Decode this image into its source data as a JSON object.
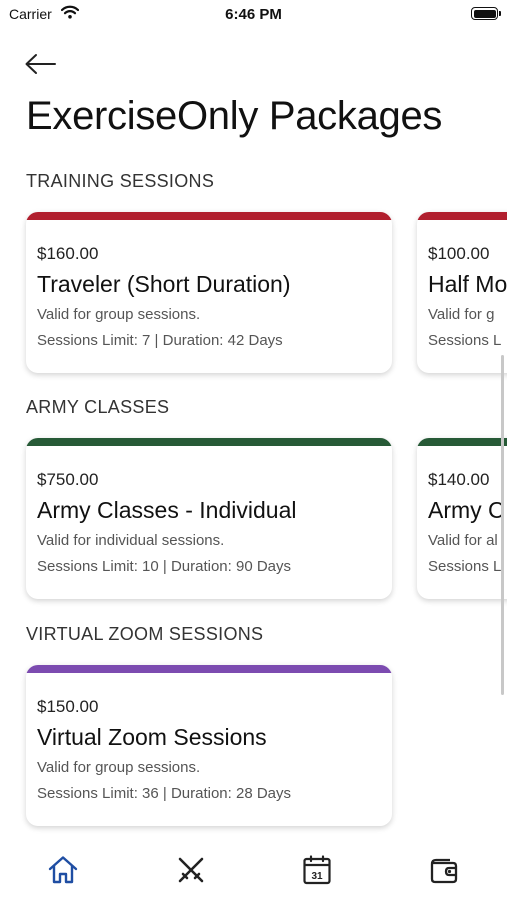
{
  "status_bar": {
    "carrier": "Carrier",
    "time": "6:46 PM"
  },
  "header": {
    "title": "ExerciseOnly Packages"
  },
  "colors": {
    "training": "#b11f2e",
    "army": "#275a37",
    "zoom": "#7c4bb0",
    "tab_active": "#1f4ea3",
    "tab_inactive": "#222222"
  },
  "sections": [
    {
      "label": "TRAINING SESSIONS",
      "cards": [
        {
          "price": "$160.00",
          "name": "Traveler (Short Duration)",
          "desc": "Valid for group sessions.",
          "limits": "Sessions Limit: 7 | Duration: 42 Days"
        },
        {
          "price": "$100.00",
          "name": "Half Mo",
          "desc": "Valid for g",
          "limits": "Sessions L"
        }
      ]
    },
    {
      "label": "ARMY CLASSES",
      "cards": [
        {
          "price": "$750.00",
          "name": "Army Classes - Individual",
          "desc": "Valid for individual sessions.",
          "limits": "Sessions Limit: 10 | Duration: 90 Days"
        },
        {
          "price": "$140.00",
          "name": "Army C",
          "desc": "Valid for al",
          "limits": "Sessions L"
        }
      ]
    },
    {
      "label": "VIRTUAL ZOOM SESSIONS",
      "cards": [
        {
          "price": "$150.00",
          "name": "Virtual Zoom Sessions",
          "desc": "Valid for group sessions.",
          "limits": "Sessions Limit: 36 | Duration: 28 Days"
        }
      ]
    }
  ],
  "tabs": [
    {
      "icon": "home-icon",
      "active": true
    },
    {
      "icon": "crossed-swords-icon",
      "active": false
    },
    {
      "icon": "calendar-icon",
      "active": false,
      "calendar_day": "31"
    },
    {
      "icon": "wallet-icon",
      "active": false
    }
  ]
}
